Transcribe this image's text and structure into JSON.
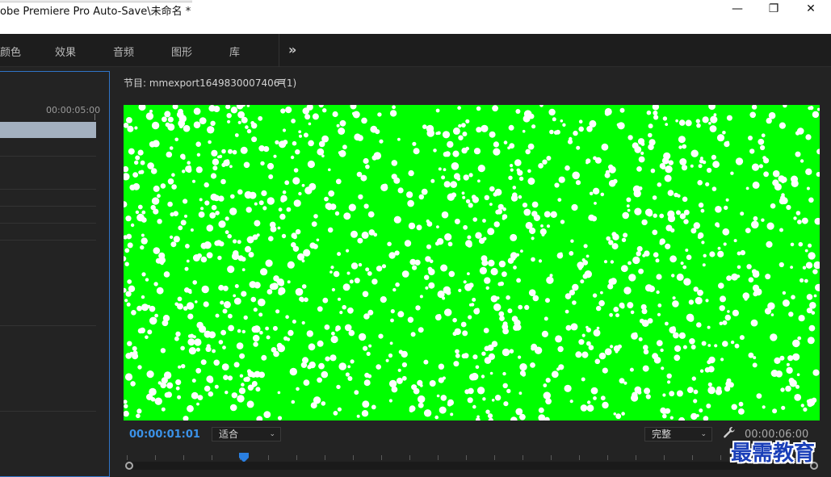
{
  "window": {
    "title": "obe Premiere Pro Auto-Save\\未命名 *",
    "controls": {
      "minimize": "—",
      "restore": "❐",
      "close": "✕"
    }
  },
  "workspace_tabs": [
    {
      "label": "颜色"
    },
    {
      "label": "效果"
    },
    {
      "label": "音频"
    },
    {
      "label": "图形"
    },
    {
      "label": "库"
    }
  ],
  "workspace_more": "»",
  "left_panel": {
    "ruler_timecode": "00:00:05:00",
    "clip_color": "#a3b0bf"
  },
  "program_monitor": {
    "title": "节目: mmexport1649830007406 (1)",
    "menu_icon": "≡",
    "frame_color": "#00ff00",
    "current_timecode": "00:00:01:01",
    "zoom_select": {
      "value": "适合"
    },
    "quality_select": {
      "value": "完整"
    },
    "duration_timecode": "00:00:06:00",
    "wrench_icon": "🔧",
    "playhead_position": 0.17
  },
  "watermark": "最需教育",
  "colors": {
    "accent_blue": "#3b92e8",
    "panel_border": "#2f74c7",
    "watermark": "#1a3fb8"
  }
}
